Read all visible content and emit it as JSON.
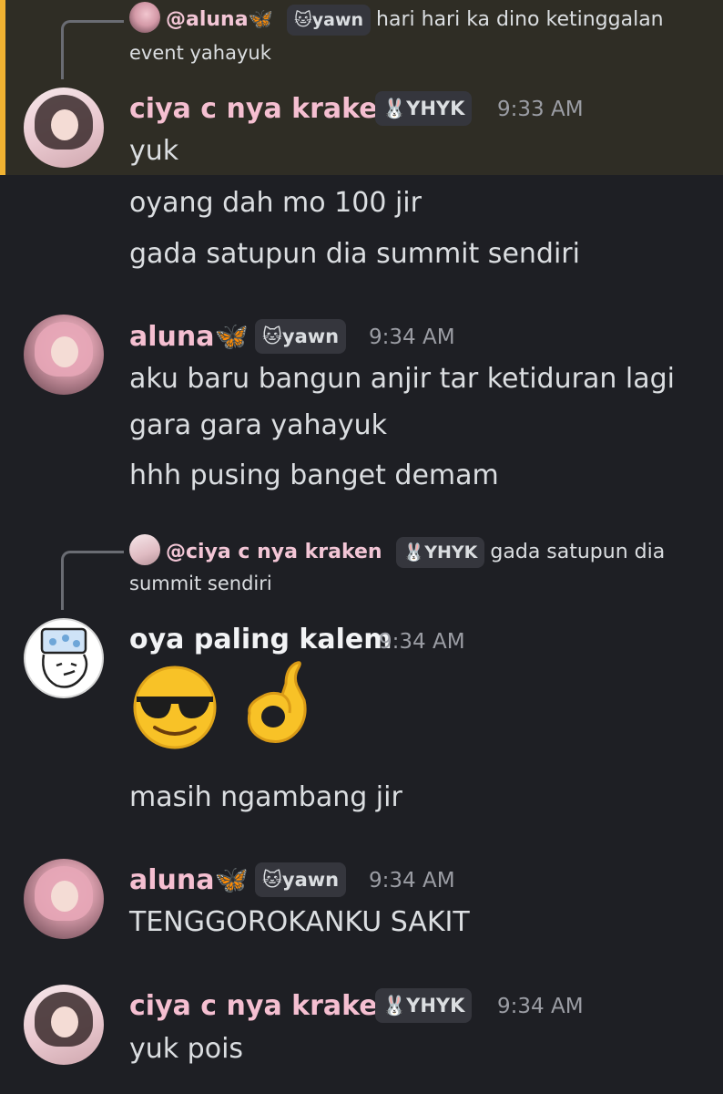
{
  "colors": {
    "background": "#1e1f24",
    "highlight": "#2f2d25",
    "highlight_bar": "#f0b232",
    "username_pink": "#f5bfd1",
    "timestamp": "#9b9da4"
  },
  "messages": [
    {
      "reply": {
        "mention": "@aluna🦋",
        "tag": "🐱yawn",
        "text_line1": "hari hari ka dino ketinggalan",
        "text_line2": "event yahayuk"
      },
      "author": "ciya c nya kraken",
      "tag": "🐰YHYK",
      "time": "9:33 AM",
      "lines": [
        "yuk",
        "oyang dah mo 100 jir",
        "gada satupun dia summit sendiri"
      ]
    },
    {
      "author": "aluna🦋",
      "tag": "🐱yawn",
      "time": "9:34 AM",
      "lines": [
        "aku baru bangun anjir tar ketiduran lagi",
        "gara gara yahayuk",
        "hhh pusing banget demam"
      ]
    },
    {
      "reply": {
        "mention": "@ciya c nya kraken",
        "tag": "🐰YHYK",
        "text_line1": "gada satupun dia",
        "text_line2": "summit sendiri"
      },
      "author": "oya paling kalem",
      "time": "9:34 AM",
      "emojis": [
        "sunglasses-face-emoji",
        "ok-hand-emoji"
      ],
      "lines": [
        "masih ngambang jir"
      ]
    },
    {
      "author": "aluna🦋",
      "tag": "🐱yawn",
      "time": "9:34 AM",
      "lines": [
        "TENGGOROKANKU SAKIT"
      ]
    },
    {
      "author": "ciya c nya kraken",
      "tag": "🐰YHYK",
      "time": "9:34 AM",
      "lines": [
        "yuk pois"
      ]
    }
  ]
}
